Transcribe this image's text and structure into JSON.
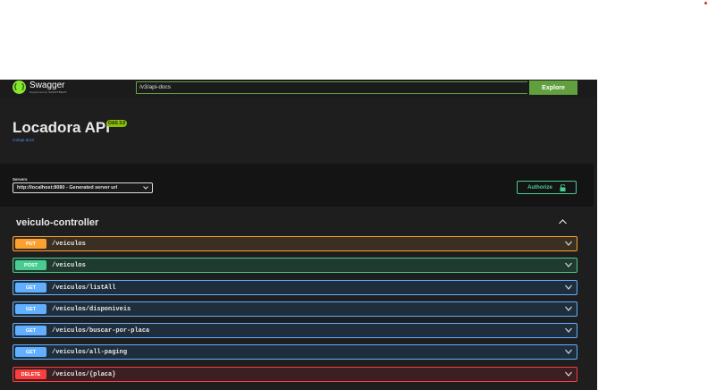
{
  "topbar": {
    "logo_name": "Swagger",
    "logo_sub": "Supported by SMARTBEAR",
    "url_value": "/v3/api-docs",
    "explore_label": "Explore"
  },
  "info": {
    "title": "Locadora API",
    "oas_badge": "OAS 3.0",
    "docs_link": "/v3/api-docs"
  },
  "servers": {
    "label": "Servers",
    "selected": "http://localhost:8080 - Generated server url",
    "authorize_label": "Authorize"
  },
  "tag": {
    "name": "veiculo-controller"
  },
  "operations": [
    {
      "method": "PUT",
      "path": "/veiculos"
    },
    {
      "method": "POST",
      "path": "/veiculos"
    },
    {
      "method": "GET",
      "path": "/veiculos/listAll"
    },
    {
      "method": "GET",
      "path": "/veiculos/disponiveis"
    },
    {
      "method": "GET",
      "path": "/veiculos/buscar-por-placa"
    },
    {
      "method": "GET",
      "path": "/veiculos/all-paging"
    },
    {
      "method": "DELETE",
      "path": "/veiculos/{placa}"
    }
  ],
  "colors": {
    "put": "#fca130",
    "post": "#49cc90",
    "get": "#61affe",
    "delete": "#f93e3e",
    "swagger_green": "#85ea2d"
  }
}
